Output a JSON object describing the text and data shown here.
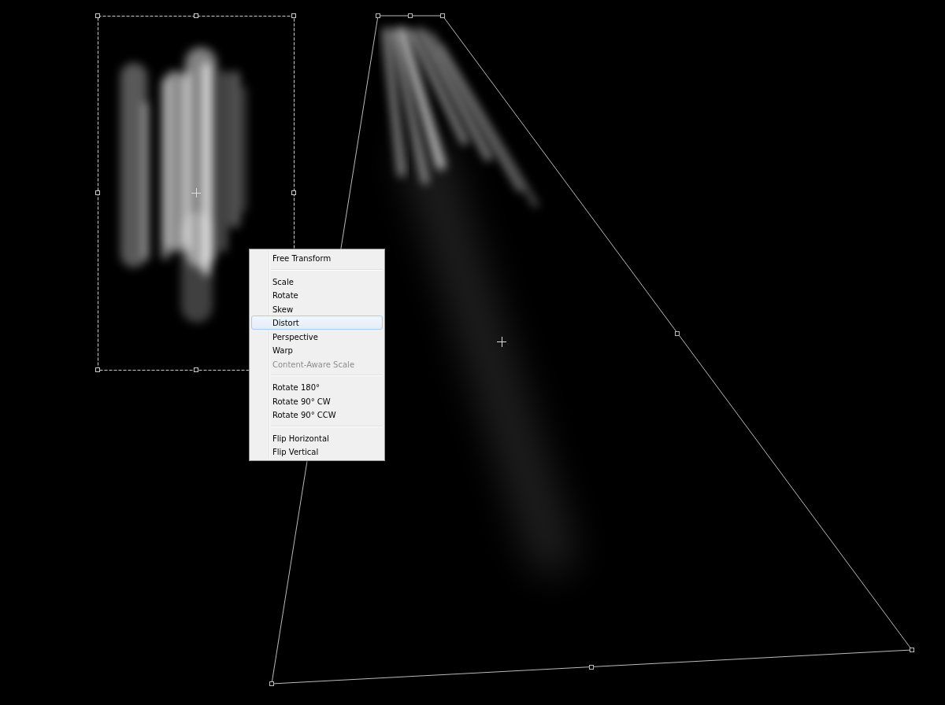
{
  "context_menu": {
    "groups": [
      {
        "items": [
          {
            "label": "Free Transform",
            "selected": false,
            "disabled": false
          }
        ]
      },
      {
        "items": [
          {
            "label": "Scale",
            "selected": false,
            "disabled": false
          },
          {
            "label": "Rotate",
            "selected": false,
            "disabled": false
          },
          {
            "label": "Skew",
            "selected": false,
            "disabled": false
          },
          {
            "label": "Distort",
            "selected": true,
            "disabled": false
          },
          {
            "label": "Perspective",
            "selected": false,
            "disabled": false
          },
          {
            "label": "Warp",
            "selected": false,
            "disabled": false
          },
          {
            "label": "Content-Aware Scale",
            "selected": false,
            "disabled": true
          }
        ]
      },
      {
        "items": [
          {
            "label": "Rotate 180°",
            "selected": false,
            "disabled": false
          },
          {
            "label": "Rotate 90° CW",
            "selected": false,
            "disabled": false
          },
          {
            "label": "Rotate 90° CCW",
            "selected": false,
            "disabled": false
          }
        ]
      },
      {
        "items": [
          {
            "label": "Flip Horizontal",
            "selected": false,
            "disabled": false
          },
          {
            "label": "Flip Vertical",
            "selected": false,
            "disabled": false
          }
        ]
      }
    ]
  }
}
